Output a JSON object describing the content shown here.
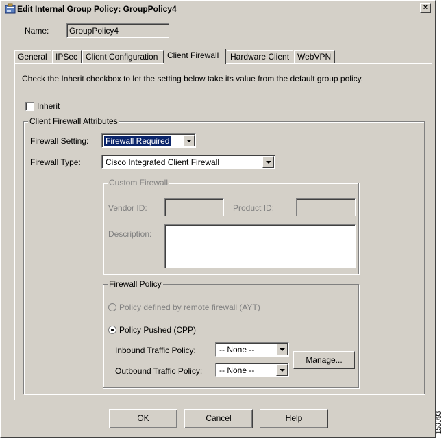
{
  "window": {
    "title": "Edit Internal Group Policy: GroupPolicy4",
    "close_glyph": "×"
  },
  "name": {
    "label": "Name:",
    "value": "GroupPolicy4"
  },
  "tabs": [
    {
      "label": "General"
    },
    {
      "label": "IPSec"
    },
    {
      "label": "Client Configuration"
    },
    {
      "label": "Client Firewall"
    },
    {
      "label": "Hardware Client"
    },
    {
      "label": "WebVPN"
    }
  ],
  "active_tab": "Client Firewall",
  "panel": {
    "instructions": "Check the Inherit checkbox to let the setting below take its value from the default group policy.",
    "inherit_label": "Inherit",
    "inherit_checked": false,
    "attributes": {
      "title": "Client Firewall Attributes",
      "firewall_setting": {
        "label": "Firewall Setting:",
        "value": "Firewall Required"
      },
      "firewall_type": {
        "label": "Firewall Type:",
        "value": "Cisco Integrated Client Firewall"
      },
      "custom_firewall": {
        "title": "Custom Firewall",
        "vendor_id_label": "Vendor ID:",
        "vendor_id_value": "",
        "product_id_label": "Product ID:",
        "product_id_value": "",
        "description_label": "Description:",
        "description_value": ""
      },
      "firewall_policy": {
        "title": "Firewall Policy",
        "option_ayt": "Policy defined by remote firewall (AYT)",
        "option_cpp": "Policy Pushed (CPP)",
        "selected": "Policy Pushed (CPP)",
        "inbound_label": "Inbound Traffic Policy:",
        "inbound_value": "-- None --",
        "outbound_label": "Outbound Traffic Policy:",
        "outbound_value": "-- None --",
        "manage_label": "Manage..."
      }
    }
  },
  "footer": {
    "ok": "OK",
    "cancel": "Cancel",
    "help": "Help"
  },
  "figure_id": "153093",
  "colors": {
    "selection": "#0a246a",
    "face": "#d4d0c8"
  }
}
